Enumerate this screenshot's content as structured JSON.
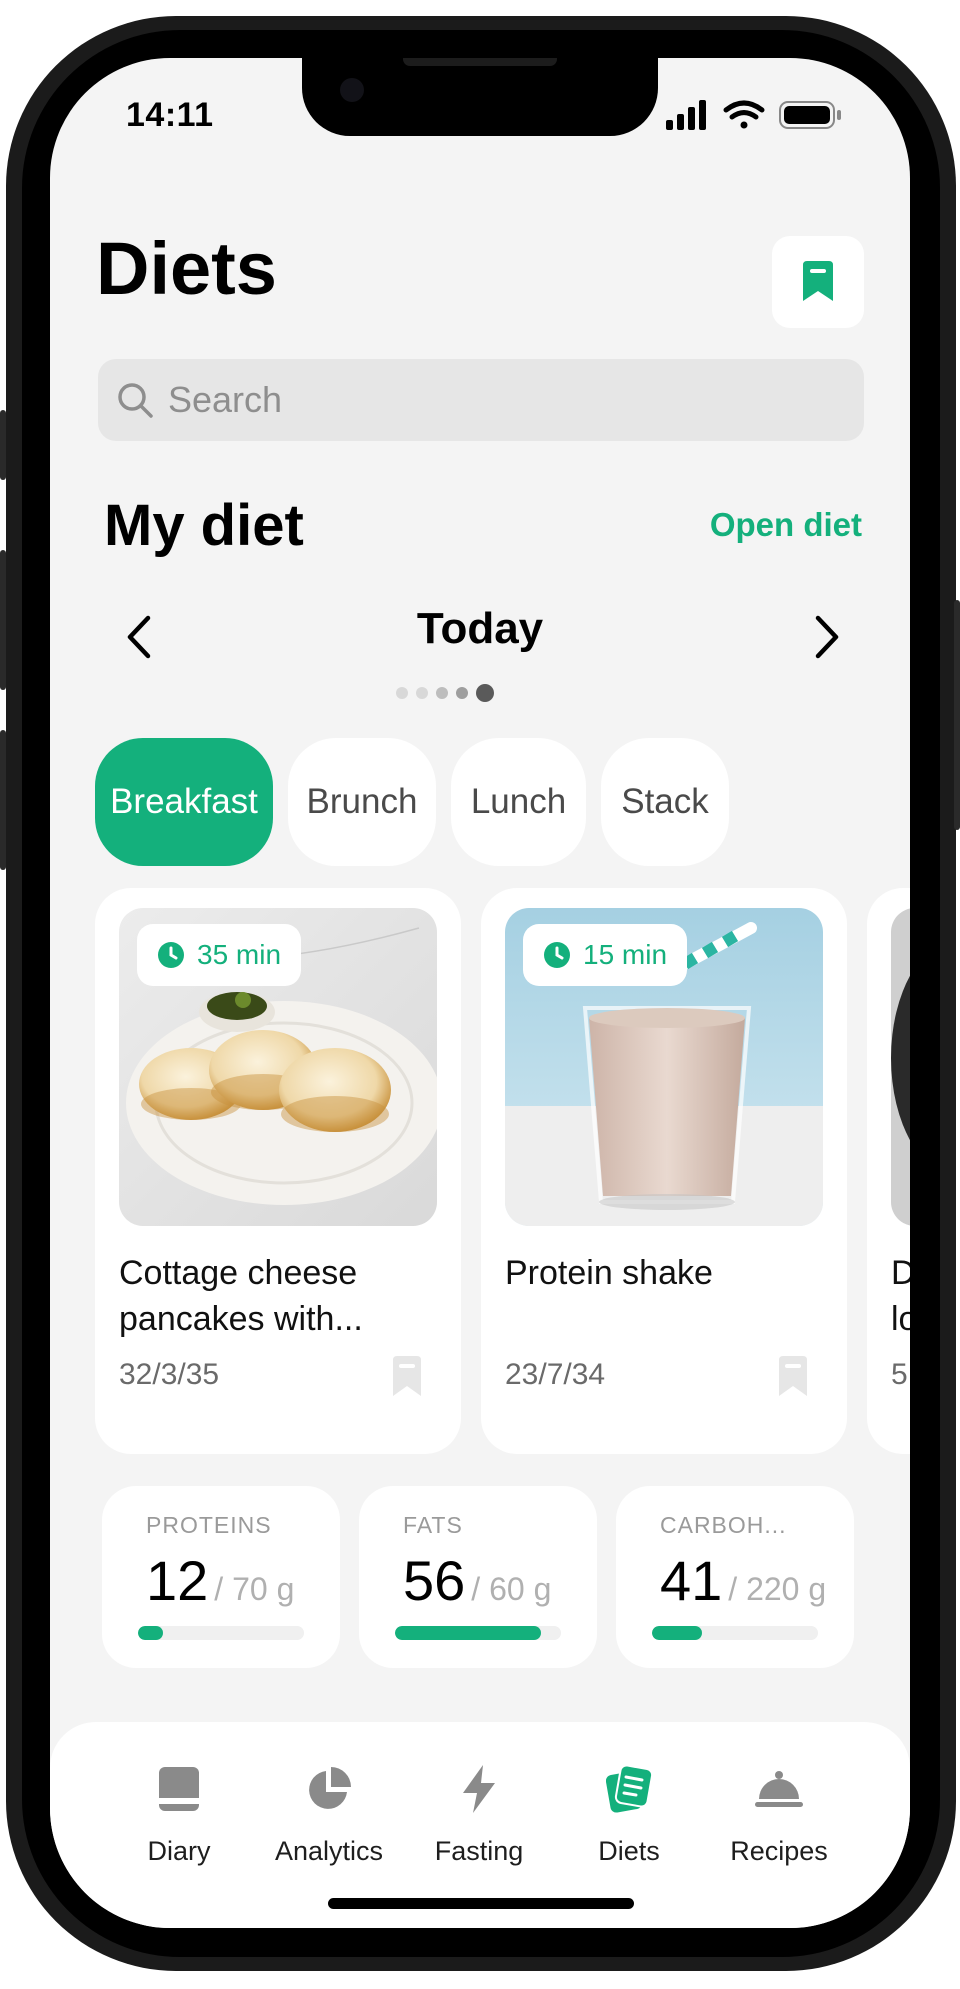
{
  "status_bar": {
    "time": "14:11"
  },
  "header": {
    "title": "Diets"
  },
  "search": {
    "placeholder": "Search"
  },
  "my_diet": {
    "title": "My diet",
    "open_link": "Open diet",
    "day_label": "Today",
    "pager": {
      "count": 5,
      "active_index": 4
    }
  },
  "meal_tabs": [
    {
      "label": "Breakfast",
      "active": true
    },
    {
      "label": "Brunch",
      "active": false
    },
    {
      "label": "Lunch",
      "active": false
    },
    {
      "label": "Stack",
      "active": false
    }
  ],
  "recipes": [
    {
      "time": "35 min",
      "name": "Cottage cheese pancakes with...",
      "macros": "32/3/35"
    },
    {
      "time": "15 min",
      "name": "Protein shake",
      "macros": "23/7/34"
    },
    {
      "time": "",
      "name": "D\nlo",
      "macros": "5"
    }
  ],
  "nutrients": [
    {
      "label": "PROTEINS",
      "value": "12",
      "goal": "/ 70 g",
      "progress": 0.15
    },
    {
      "label": "FATS",
      "value": "56",
      "goal": "/ 60 g",
      "progress": 0.88
    },
    {
      "label": "CARBOH...",
      "value": "41",
      "goal": "/ 220 g",
      "progress": 0.3
    }
  ],
  "tab_bar": [
    {
      "label": "Diary",
      "icon": "diary-icon",
      "active": false
    },
    {
      "label": "Analytics",
      "icon": "pie-chart-icon",
      "active": false
    },
    {
      "label": "Fasting",
      "icon": "lightning-icon",
      "active": false
    },
    {
      "label": "Diets",
      "icon": "diets-icon",
      "active": true
    },
    {
      "label": "Recipes",
      "icon": "cloche-icon",
      "active": false
    }
  ],
  "colors": {
    "accent": "#14b07c",
    "background": "#f4f4f4",
    "card": "#ffffff"
  }
}
